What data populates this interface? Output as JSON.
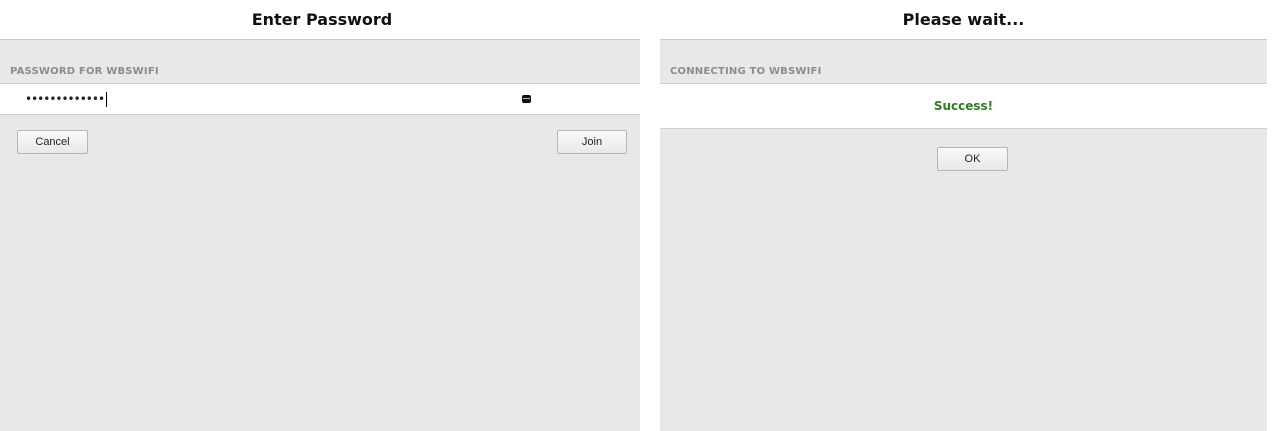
{
  "left_dialog": {
    "title": "Enter Password",
    "section_header": "PASSWORD FOR WBSWIFI",
    "password_value": "•••••••••••••",
    "keyboard_icon": "keyboard-icon",
    "cancel_label": "Cancel",
    "join_label": "Join"
  },
  "right_dialog": {
    "title": "Please wait...",
    "section_header": "CONNECTING TO WBSWIFI",
    "status_text": "Success!",
    "status_color": "#2e7d1e",
    "ok_label": "OK"
  }
}
